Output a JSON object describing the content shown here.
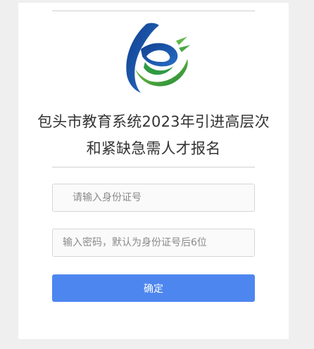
{
  "page": {
    "title_line1": "包头市教育系统2023年引进高层次",
    "title_line2": "和紧缺急需人才报名"
  },
  "form": {
    "id_placeholder": "请输入身份证号",
    "id_value": "",
    "password_placeholder": "输入密码，默认为身份证号后6位",
    "password_value": "",
    "submit_label": "确定"
  },
  "colors": {
    "background": "#efefef",
    "card": "#ffffff",
    "button": "#4e86f0",
    "logo_blue": "#1a56a8",
    "logo_green": "#3aa341"
  },
  "icons": {
    "logo": "education-bureau-logo"
  }
}
